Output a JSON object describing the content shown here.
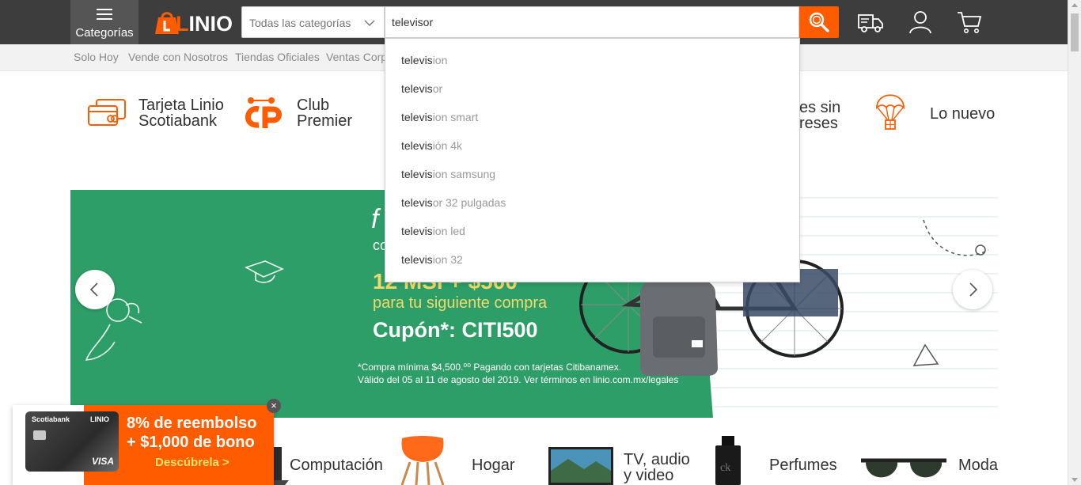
{
  "header": {
    "categories_label": "Categorías",
    "logo_text": "LINIO",
    "category_select": "Todas las categorías",
    "search_value": "televisor",
    "icons": [
      "search-icon",
      "truck-icon",
      "user-icon",
      "cart-icon"
    ],
    "brand_color": "#ff5c00",
    "bar_color": "#3d3d3d"
  },
  "subnav": {
    "items": [
      "Solo Hoy",
      "Vende con Nosotros",
      "Tiendas Oficiales",
      "Ventas Corp"
    ]
  },
  "suggestions": {
    "typed": "televis",
    "items": [
      {
        "rest": "ion"
      },
      {
        "rest": "or"
      },
      {
        "rest": "ion smart"
      },
      {
        "rest": "ión 4k"
      },
      {
        "rest": "ion samsung"
      },
      {
        "rest": "or 32 pulgadas"
      },
      {
        "rest": "ion led"
      },
      {
        "rest": "ion 32"
      }
    ]
  },
  "quicklinks": {
    "tarjeta_line1": "Tarjeta Linio",
    "tarjeta_line2": "Scotiabank",
    "club_line1": "Club",
    "club_line2": "Premier",
    "msi_line1": "es sin",
    "msi_line2": "reses",
    "nuevo": "Lo nuevo"
  },
  "banner": {
    "heading_partial": "f",
    "sub_partial": "co",
    "msi": "12 MSI + $500",
    "line2": "para tu siguiente compra",
    "coupon": "Cupón*: CITI500",
    "fine1": "*Compra mínima $4,500.⁰⁰ Pagando con tarjetas Citibanamex.",
    "fine2": "Válido del 05 al 11 de agosto del 2019. Ver términos en linio.com.mx/legales"
  },
  "categories": {
    "computacion": "Computación",
    "hogar": "Hogar",
    "tv_line1": "TV, audio",
    "tv_line2": "y video",
    "perfumes": "Perfumes",
    "moda": "Moda"
  },
  "promo": {
    "line1": "8% de reembolso",
    "line2": "+ $1,000 de bono",
    "cta": "Descúbrela >",
    "card_bank": "Scotiabank",
    "card_brand": "LINIO",
    "card_network": "VISA",
    "close": "×"
  }
}
